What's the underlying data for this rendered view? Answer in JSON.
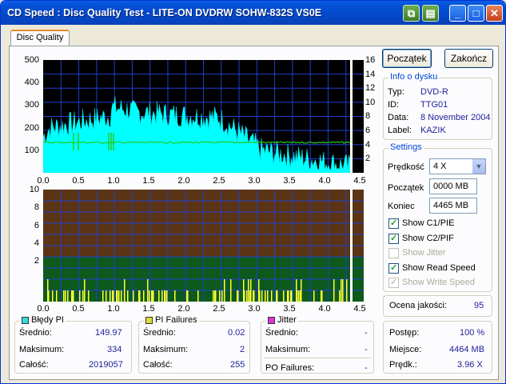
{
  "window": {
    "title": "CD Speed : Disc Quality Test - LITE-ON DVDRW SOHW-832S  VS0E",
    "minimize": "_",
    "maximize": "□",
    "close": "✕"
  },
  "tabs": [
    {
      "label": "Disc Quality"
    }
  ],
  "top_chart": {
    "left_ticks": [
      "500",
      "400",
      "300",
      "200",
      "100"
    ],
    "right_ticks": [
      "16",
      "14",
      "12",
      "10",
      "8",
      "6",
      "4",
      "2"
    ],
    "x_ticks": [
      "0.0",
      "0.5",
      "1.0",
      "1.5",
      "2.0",
      "2.5",
      "3.0",
      "3.5",
      "4.0",
      "4.5"
    ]
  },
  "bottom_chart": {
    "left_ticks": [
      "10",
      "8",
      "6",
      "4",
      "2"
    ],
    "x_ticks": [
      "0.0",
      "0.5",
      "1.0",
      "1.5",
      "2.0",
      "2.5",
      "3.0",
      "3.5",
      "4.0",
      "4.5"
    ]
  },
  "buttons": {
    "start": "Początek",
    "exit": "Zakończ"
  },
  "disc_info": {
    "title": "Info o dysku",
    "type_label": "Typ:",
    "type_value": "DVD-R",
    "id_label": "ID:",
    "id_value": "TTG01",
    "date_label": "Data:",
    "date_value": "8 November 2004",
    "label_label": "Label:",
    "label_value": "KAZIK"
  },
  "settings": {
    "title": "Settings",
    "speed_label": "Prędkość",
    "speed_value": "4 X",
    "start_label": "Początek",
    "start_value": "0000 MB",
    "end_label": "Koniec",
    "end_value": "4465 MB",
    "checks": [
      {
        "label": "Show C1/PIE",
        "checked": true,
        "enabled": true
      },
      {
        "label": "Show C2/PIF",
        "checked": true,
        "enabled": true
      },
      {
        "label": "Show Jitter",
        "checked": false,
        "enabled": false
      },
      {
        "label": "Show Read Speed",
        "checked": true,
        "enabled": true
      },
      {
        "label": "Show Write Speed",
        "checked": true,
        "enabled": false
      }
    ]
  },
  "quality": {
    "label": "Ocena jakości:",
    "value": "95"
  },
  "progress": {
    "progress_label": "Postęp:",
    "progress_value": "100 %",
    "position_label": "Miejsce:",
    "position_value": "4464 MB",
    "speed_label": "Prędk.:",
    "speed_value": "3.96 X"
  },
  "stats": {
    "pi_errors": {
      "title": "Błędy PI",
      "color": "#33dddd",
      "avg_label": "Średnio:",
      "avg": "149.97",
      "max_label": "Maksimum:",
      "max": "334",
      "total_label": "Całość:",
      "total": "2019057"
    },
    "pi_failures": {
      "title": "PI Failures",
      "color": "#dddd33",
      "avg_label": "Średnio:",
      "avg": "0.02",
      "max_label": "Maksimum:",
      "max": "2",
      "total_label": "Całość:",
      "total": "255"
    },
    "jitter": {
      "title": "Jitter",
      "color": "#dd33dd",
      "avg_label": "Średnio:",
      "avg": "-",
      "max_label": "Maksimum:",
      "max": "-",
      "po_label": "PO Failures:",
      "po": "-"
    }
  },
  "colors": {
    "pie": "#00ffff",
    "speed_line": "#22cc22",
    "grid": "#1e3fd0",
    "pif": "#ffff33",
    "bottom_upper": "#5a3414",
    "bottom_lower": "#0d5a1c"
  }
}
